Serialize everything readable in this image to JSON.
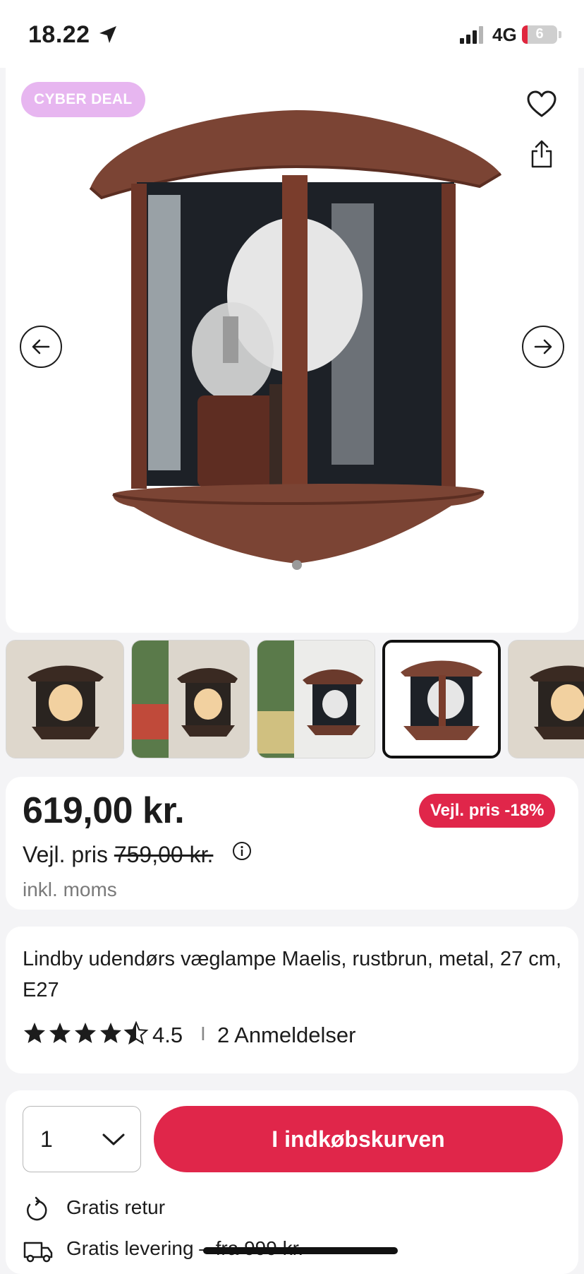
{
  "status_bar": {
    "time": "18.22",
    "network": "4G",
    "battery": "6"
  },
  "gallery": {
    "badge": "CYBER DEAL",
    "favorite_icon": "heart-icon",
    "share_icon": "share-icon",
    "prev_icon": "arrow-left-icon",
    "next_icon": "arrow-right-icon",
    "thumbnails_count": 5,
    "selected_thumbnail": 4
  },
  "price": {
    "current": "619,00 kr.",
    "badge": "Vejl. pris -18%",
    "rrp_label": "Vejl. pris",
    "rrp_value": "759,00 kr.",
    "vat": "inkl. moms"
  },
  "product": {
    "title": "Lindby udendørs væglampe Maelis, rustbrun, metal, 27 cm, E27",
    "rating": "4.5",
    "rating_value": 4.5,
    "separator": "I",
    "reviews": "2 Anmeldelser"
  },
  "cart": {
    "quantity": "1",
    "add_button": "I indkøbskurven",
    "features": [
      {
        "icon": "return-icon",
        "label": "Gratis retur"
      },
      {
        "icon": "truck-icon",
        "label": "Gratis levering – fra 999 kr."
      }
    ]
  },
  "colors": {
    "accent": "#e0264a",
    "badge": "#e7b6f0",
    "muted_text": "#7a7a7a",
    "lamp": "#7a3d2c"
  }
}
